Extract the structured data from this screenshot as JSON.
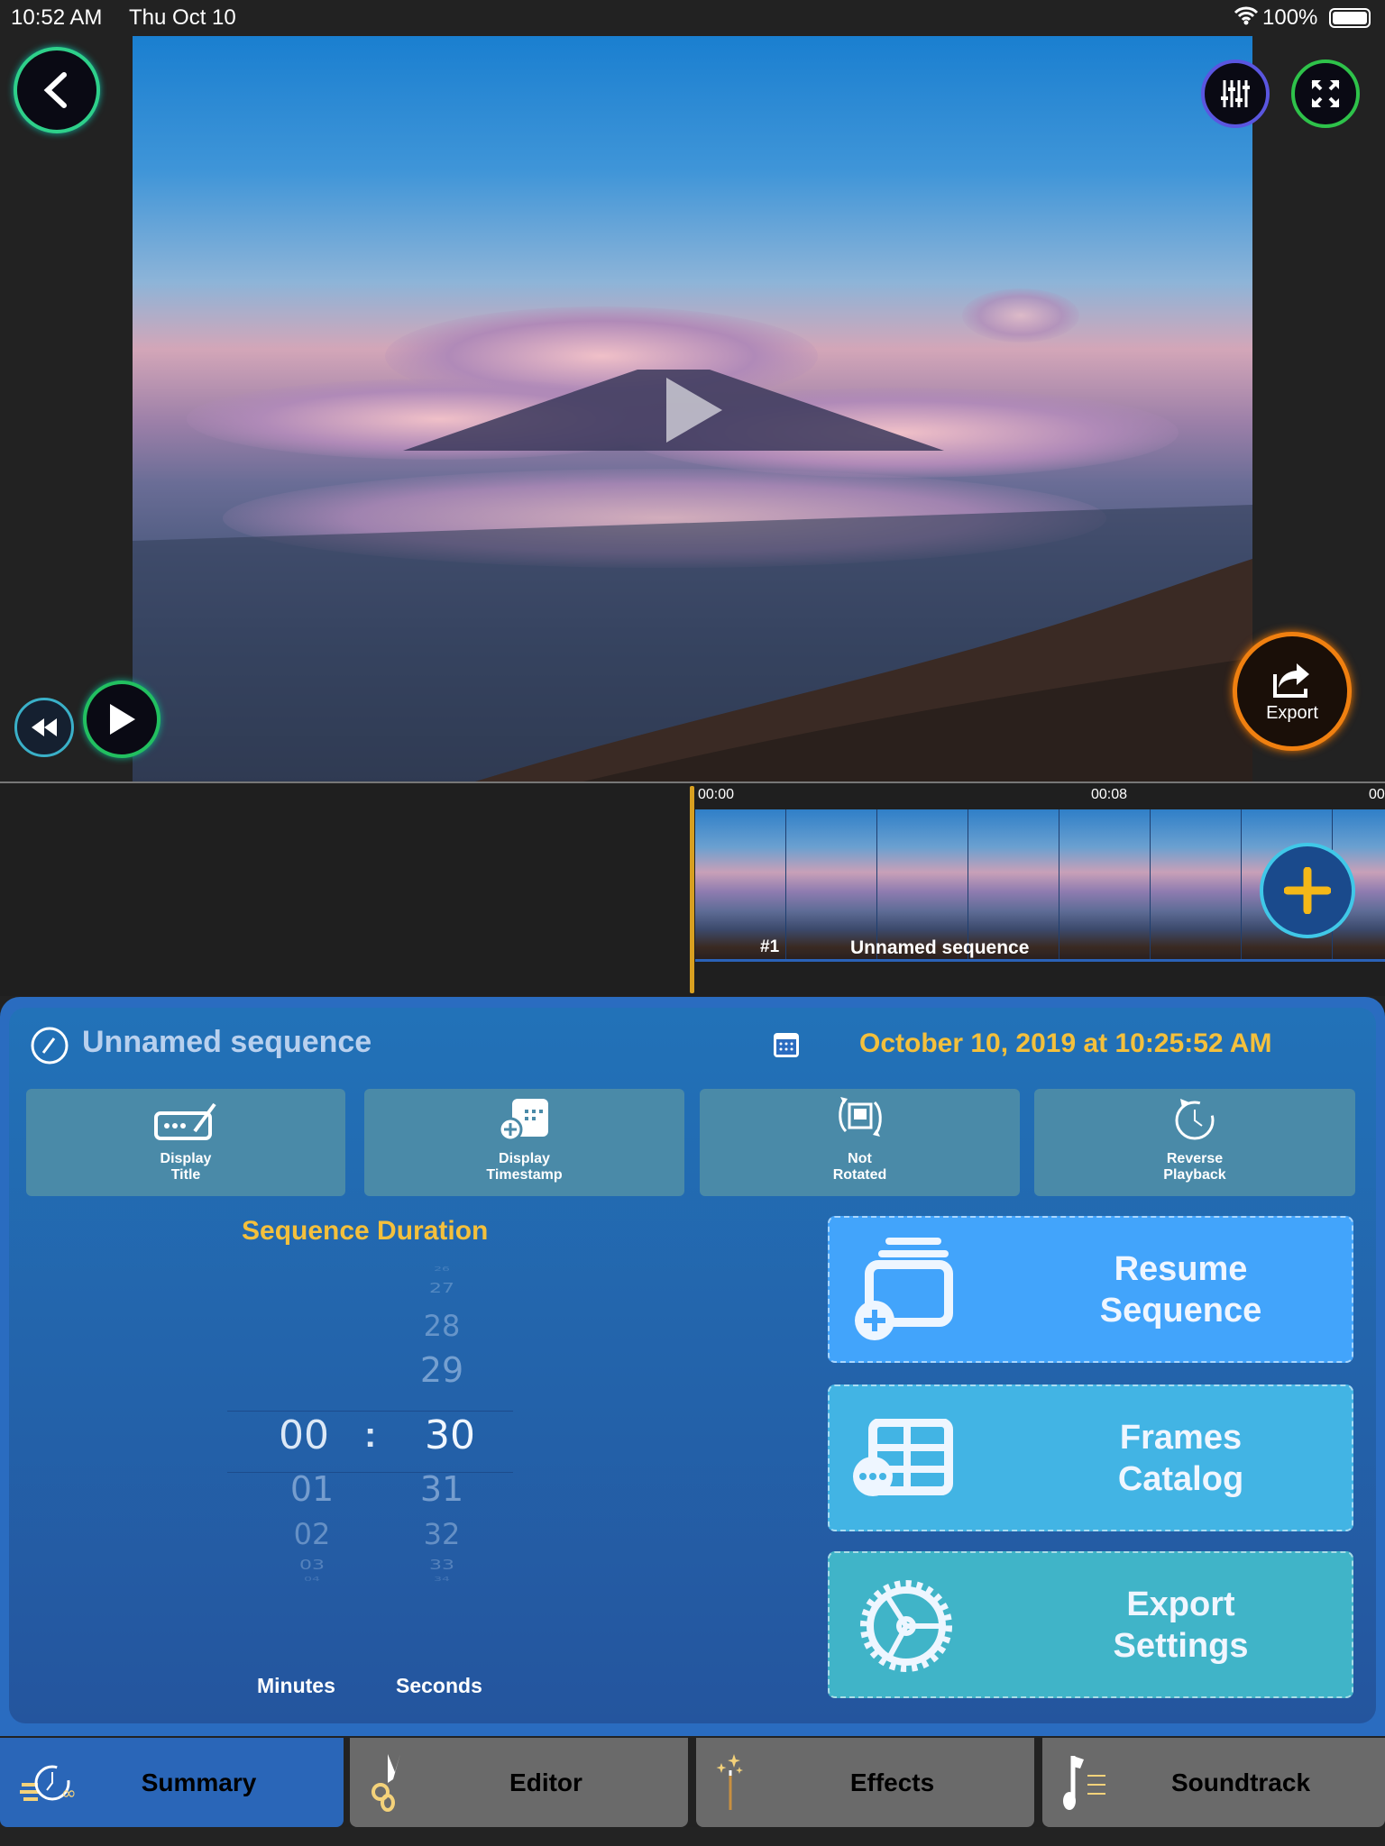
{
  "status_bar": {
    "time": "10:52 AM",
    "date": "Thu Oct 10",
    "battery": "100%"
  },
  "player": {
    "export_label": "Export",
    "play_overlay_icon": "play-icon"
  },
  "timeline": {
    "ticks": [
      "00:00",
      "00:08",
      "00"
    ],
    "clip_number": "#1",
    "clip_name": "Unnamed sequence"
  },
  "summary": {
    "title": "Unnamed sequence",
    "timestamp": "October 10, 2019 at 10:25:52 AM",
    "options": [
      {
        "line1": "Display",
        "line2": "Title"
      },
      {
        "line1": "Display",
        "line2": "Timestamp"
      },
      {
        "line1": "Not",
        "line2": "Rotated"
      },
      {
        "line1": "Reverse",
        "line2": "Playback"
      }
    ],
    "duration": {
      "label": "Sequence Duration",
      "minutes": {
        "selected": "00",
        "below": [
          "01",
          "02",
          "03",
          "04"
        ]
      },
      "seconds": {
        "above": [
          "26",
          "27",
          "28",
          "29"
        ],
        "selected": "30",
        "below": [
          "31",
          "32",
          "33",
          "34"
        ]
      },
      "separator": ":",
      "minutes_label": "Minutes",
      "seconds_label": "Seconds"
    },
    "actions": [
      {
        "line1": "Resume",
        "line2": "Sequence",
        "color": "#42a4fb"
      },
      {
        "line1": "Frames",
        "line2": "Catalog",
        "color": "#42b4e4"
      },
      {
        "line1": "Export",
        "line2": "Settings",
        "color": "#40b4c8"
      }
    ]
  },
  "tabs": [
    {
      "label": "Summary",
      "active": true
    },
    {
      "label": "Editor"
    },
    {
      "label": "Effects"
    },
    {
      "label": "Soundtrack"
    }
  ],
  "colors": {
    "accent": "#f4c03c",
    "panel": "#2a6cc0",
    "tab_active": "#2a66b8",
    "tab_inactive": "#6a6a6a"
  }
}
